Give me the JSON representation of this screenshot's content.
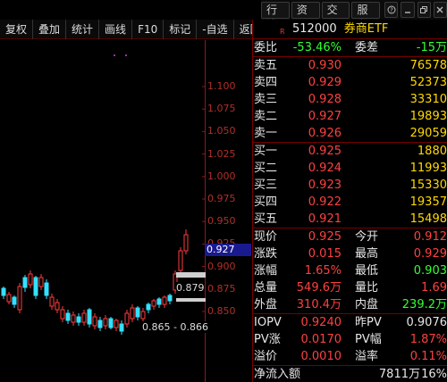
{
  "top_tabs": [
    "行情",
    "资讯",
    "交易",
    "服务"
  ],
  "window_buttons": [
    "help",
    "minimize",
    "restore",
    "close"
  ],
  "toolbar": [
    "复权",
    "叠加",
    "统计",
    "画线",
    "F10",
    "标记",
    "-自选",
    "返回"
  ],
  "chart": {
    "price_axis": [
      "1.100",
      "1.075",
      "1.050",
      "1.025",
      "1.000",
      "0.975",
      "0.950",
      "0.925",
      "0.900",
      "0.875",
      "0.850"
    ],
    "current_price": "0.927",
    "ann_high": "0.879",
    "ann_range": "0.865 - 0.866",
    "colors": {
      "up": "#ff3b3b",
      "down": "#33e0ff",
      "axis": "#b0302a",
      "current_bg": "#1a1a90"
    }
  },
  "quote": {
    "badge": "R",
    "code": "512000",
    "name": "券商ETF",
    "weibi_label": "委比",
    "weibi_value": "-53.46%",
    "weicha_label": "委差",
    "weicha_value": "-15万",
    "asks": [
      {
        "label": "卖五",
        "price": "0.930",
        "vol": "76578"
      },
      {
        "label": "卖四",
        "price": "0.929",
        "vol": "52373"
      },
      {
        "label": "卖三",
        "price": "0.928",
        "vol": "33310"
      },
      {
        "label": "卖二",
        "price": "0.927",
        "vol": "19893"
      },
      {
        "label": "卖一",
        "price": "0.926",
        "vol": "29059"
      }
    ],
    "bids": [
      {
        "label": "买一",
        "price": "0.925",
        "vol": "1880"
      },
      {
        "label": "买二",
        "price": "0.924",
        "vol": "11993"
      },
      {
        "label": "买三",
        "price": "0.923",
        "vol": "15330"
      },
      {
        "label": "买四",
        "price": "0.922",
        "vol": "19357"
      },
      {
        "label": "买五",
        "price": "0.921",
        "vol": "15498"
      }
    ],
    "stats": [
      {
        "l1": "现价",
        "v1": "0.925",
        "l2": "今开",
        "v2": "0.912"
      },
      {
        "l1": "涨跌",
        "v1": "0.015",
        "l2": "最高",
        "v2": "0.929"
      },
      {
        "l1": "涨幅",
        "v1": "1.65%",
        "l2": "最低",
        "v2": "0.903"
      },
      {
        "l1": "总量",
        "v1": "549.6万",
        "l2": "量比",
        "v2": "1.69"
      },
      {
        "l1": "外盘",
        "v1": "310.4万",
        "l2": "内盘",
        "v2": "239.2万"
      }
    ],
    "iopv": [
      {
        "l1": "IOPV",
        "v1": "0.9240",
        "l2": "昨PV",
        "v2": "0.9076"
      },
      {
        "l1": "PV涨",
        "v1": "0.0170",
        "l2": "PV幅",
        "v2": "1.87%"
      },
      {
        "l1": "溢价",
        "v1": "0.0010",
        "l2": "溢率",
        "v2": "0.11%"
      }
    ],
    "net_inflow_label": "净流入额",
    "net_inflow_value": "7811万",
    "net_inflow_extra": "16%"
  }
}
